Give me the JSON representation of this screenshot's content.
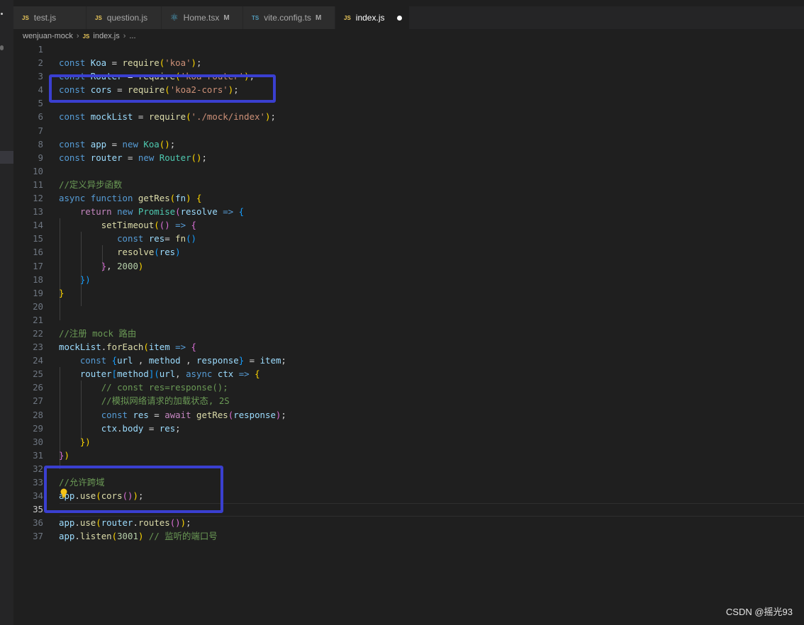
{
  "tabs": [
    {
      "label": "test.js",
      "icon": "JS",
      "type": "js",
      "modified": ""
    },
    {
      "label": "question.js",
      "icon": "JS",
      "type": "js",
      "modified": ""
    },
    {
      "label": "Home.tsx",
      "icon": "react",
      "type": "react",
      "modified": "M"
    },
    {
      "label": "vite.config.ts",
      "icon": "TS",
      "type": "ts",
      "modified": "M"
    },
    {
      "label": "index.js",
      "icon": "JS",
      "type": "js",
      "modified": "",
      "active": true,
      "unsaved": true
    }
  ],
  "breadcrumb": {
    "folder": "wenjuan-mock",
    "file": "index.js",
    "more": "...",
    "file_icon": "JS"
  },
  "lines": [
    {
      "n": "1",
      "tokens": []
    },
    {
      "n": "2",
      "tokens": [
        [
          "kw",
          "const "
        ],
        [
          "var",
          "Koa"
        ],
        [
          "pl",
          " = "
        ],
        [
          "fn",
          "require"
        ],
        [
          "b1",
          "("
        ],
        [
          "str",
          "'koa'"
        ],
        [
          "b1",
          ")"
        ],
        [
          "pl",
          ";"
        ]
      ]
    },
    {
      "n": "3",
      "tokens": [
        [
          "kw",
          "const "
        ],
        [
          "var",
          "Router"
        ],
        [
          "pl",
          " = "
        ],
        [
          "fn",
          "require"
        ],
        [
          "b1",
          "("
        ],
        [
          "str",
          "'koa-router'"
        ],
        [
          "b1",
          ")"
        ],
        [
          "pl",
          ";"
        ]
      ]
    },
    {
      "n": "4",
      "tokens": [
        [
          "kw",
          "const "
        ],
        [
          "var",
          "cors"
        ],
        [
          "pl",
          " = "
        ],
        [
          "fn",
          "require"
        ],
        [
          "b1",
          "("
        ],
        [
          "str",
          "'koa2-cors'"
        ],
        [
          "b1",
          ")"
        ],
        [
          "pl",
          ";"
        ]
      ]
    },
    {
      "n": "5",
      "tokens": []
    },
    {
      "n": "6",
      "tokens": [
        [
          "kw",
          "const "
        ],
        [
          "var",
          "mockList"
        ],
        [
          "pl",
          " = "
        ],
        [
          "fn",
          "require"
        ],
        [
          "b1",
          "("
        ],
        [
          "str",
          "'./mock/index'"
        ],
        [
          "b1",
          ")"
        ],
        [
          "pl",
          ";"
        ]
      ]
    },
    {
      "n": "7",
      "tokens": []
    },
    {
      "n": "8",
      "tokens": [
        [
          "kw",
          "const "
        ],
        [
          "var",
          "app"
        ],
        [
          "pl",
          " = "
        ],
        [
          "kw",
          "new "
        ],
        [
          "cls",
          "Koa"
        ],
        [
          "b1",
          "()"
        ],
        [
          "pl",
          ";"
        ]
      ]
    },
    {
      "n": "9",
      "tokens": [
        [
          "kw",
          "const "
        ],
        [
          "var",
          "router"
        ],
        [
          "pl",
          " = "
        ],
        [
          "kw",
          "new "
        ],
        [
          "cls",
          "Router"
        ],
        [
          "b1",
          "()"
        ],
        [
          "pl",
          ";"
        ]
      ]
    },
    {
      "n": "10",
      "tokens": []
    },
    {
      "n": "11",
      "tokens": [
        [
          "cm",
          "//定义异步函数"
        ]
      ]
    },
    {
      "n": "12",
      "tokens": [
        [
          "kw",
          "async "
        ],
        [
          "kw",
          "function "
        ],
        [
          "fn",
          "getRes"
        ],
        [
          "b1",
          "("
        ],
        [
          "var",
          "fn"
        ],
        [
          "b1",
          ")"
        ],
        [
          "pl",
          " "
        ],
        [
          "b1",
          "{"
        ]
      ]
    },
    {
      "n": "13",
      "tokens": [
        [
          "pl",
          "    "
        ],
        [
          "ctl",
          "return "
        ],
        [
          "kw",
          "new "
        ],
        [
          "cls",
          "Promise"
        ],
        [
          "b2",
          "("
        ],
        [
          "var",
          "resolve"
        ],
        [
          "pl",
          " "
        ],
        [
          "kw",
          "=>"
        ],
        [
          "pl",
          " "
        ],
        [
          "b3",
          "{"
        ]
      ]
    },
    {
      "n": "14",
      "tokens": [
        [
          "pl",
          "        "
        ],
        [
          "fn",
          "setTimeout"
        ],
        [
          "b1",
          "("
        ],
        [
          "b2",
          "()"
        ],
        [
          "pl",
          " "
        ],
        [
          "kw",
          "=>"
        ],
        [
          "pl",
          " "
        ],
        [
          "b2",
          "{"
        ]
      ]
    },
    {
      "n": "15",
      "tokens": [
        [
          "pl",
          "           "
        ],
        [
          "kw",
          "const "
        ],
        [
          "var",
          "res"
        ],
        [
          "pl",
          "= "
        ],
        [
          "fn",
          "fn"
        ],
        [
          "b3",
          "()"
        ]
      ]
    },
    {
      "n": "16",
      "tokens": [
        [
          "pl",
          "           "
        ],
        [
          "fn",
          "resolve"
        ],
        [
          "b3",
          "("
        ],
        [
          "var",
          "res"
        ],
        [
          "b3",
          ")"
        ]
      ]
    },
    {
      "n": "17",
      "tokens": [
        [
          "pl",
          "        "
        ],
        [
          "b2",
          "}"
        ],
        [
          "pl",
          ", "
        ],
        [
          "num",
          "2000"
        ],
        [
          "b1",
          ")"
        ]
      ]
    },
    {
      "n": "18",
      "tokens": [
        [
          "pl",
          "    "
        ],
        [
          "b3",
          "})"
        ]
      ]
    },
    {
      "n": "19",
      "tokens": [
        [
          "b1",
          "}"
        ]
      ]
    },
    {
      "n": "20",
      "tokens": []
    },
    {
      "n": "21",
      "tokens": []
    },
    {
      "n": "22",
      "tokens": [
        [
          "cm",
          "//注册 mock 路由"
        ]
      ]
    },
    {
      "n": "23",
      "tokens": [
        [
          "var",
          "mockList"
        ],
        [
          "pl",
          "."
        ],
        [
          "fn",
          "forEach"
        ],
        [
          "b1",
          "("
        ],
        [
          "var",
          "item"
        ],
        [
          "pl",
          " "
        ],
        [
          "kw",
          "=>"
        ],
        [
          "pl",
          " "
        ],
        [
          "b2",
          "{"
        ]
      ]
    },
    {
      "n": "24",
      "tokens": [
        [
          "pl",
          "    "
        ],
        [
          "kw",
          "const "
        ],
        [
          "b3",
          "{"
        ],
        [
          "var",
          "url"
        ],
        [
          "pl",
          " , "
        ],
        [
          "var",
          "method"
        ],
        [
          "pl",
          " , "
        ],
        [
          "var",
          "response"
        ],
        [
          "b3",
          "}"
        ],
        [
          "pl",
          " = "
        ],
        [
          "var",
          "item"
        ],
        [
          "pl",
          ";"
        ]
      ]
    },
    {
      "n": "25",
      "tokens": [
        [
          "pl",
          "    "
        ],
        [
          "var",
          "router"
        ],
        [
          "b3",
          "["
        ],
        [
          "var",
          "method"
        ],
        [
          "b3",
          "]"
        ],
        [
          "b3",
          "("
        ],
        [
          "var",
          "url"
        ],
        [
          "pl",
          ", "
        ],
        [
          "kw",
          "async "
        ],
        [
          "var",
          "ctx"
        ],
        [
          "pl",
          " "
        ],
        [
          "kw",
          "=>"
        ],
        [
          "pl",
          " "
        ],
        [
          "b1",
          "{"
        ]
      ]
    },
    {
      "n": "26",
      "tokens": [
        [
          "pl",
          "        "
        ],
        [
          "cm",
          "// const res=response();"
        ]
      ]
    },
    {
      "n": "27",
      "tokens": [
        [
          "pl",
          "        "
        ],
        [
          "cm",
          "//模拟网络请求的加载状态, 2S"
        ]
      ]
    },
    {
      "n": "28",
      "tokens": [
        [
          "pl",
          "        "
        ],
        [
          "kw",
          "const "
        ],
        [
          "var",
          "res"
        ],
        [
          "pl",
          " = "
        ],
        [
          "ctl",
          "await "
        ],
        [
          "fn",
          "getRes"
        ],
        [
          "b2",
          "("
        ],
        [
          "var",
          "response"
        ],
        [
          "b2",
          ")"
        ],
        [
          "pl",
          ";"
        ]
      ]
    },
    {
      "n": "29",
      "tokens": [
        [
          "pl",
          "        "
        ],
        [
          "var",
          "ctx"
        ],
        [
          "pl",
          "."
        ],
        [
          "var",
          "body"
        ],
        [
          "pl",
          " = "
        ],
        [
          "var",
          "res"
        ],
        [
          "pl",
          ";"
        ]
      ]
    },
    {
      "n": "30",
      "tokens": [
        [
          "pl",
          "    "
        ],
        [
          "b1",
          "})"
        ]
      ]
    },
    {
      "n": "31",
      "tokens": [
        [
          "b2",
          "}"
        ],
        [
          "b1",
          ")"
        ]
      ]
    },
    {
      "n": "32",
      "tokens": []
    },
    {
      "n": "33",
      "tokens": [
        [
          "cm",
          "//允许跨域"
        ]
      ]
    },
    {
      "n": "34",
      "tokens": [
        [
          "var",
          "app"
        ],
        [
          "pl",
          "."
        ],
        [
          "fn",
          "use"
        ],
        [
          "b1",
          "("
        ],
        [
          "fn",
          "cors"
        ],
        [
          "b2",
          "()"
        ],
        [
          "b1",
          ")"
        ],
        [
          "pl",
          ";"
        ]
      ]
    },
    {
      "n": "35",
      "tokens": [],
      "current": true
    },
    {
      "n": "36",
      "tokens": [
        [
          "var",
          "app"
        ],
        [
          "pl",
          "."
        ],
        [
          "fn",
          "use"
        ],
        [
          "b1",
          "("
        ],
        [
          "var",
          "router"
        ],
        [
          "pl",
          "."
        ],
        [
          "fn",
          "routes"
        ],
        [
          "b2",
          "()"
        ],
        [
          "b1",
          ")"
        ],
        [
          "pl",
          ";"
        ]
      ]
    },
    {
      "n": "37",
      "tokens": [
        [
          "var",
          "app"
        ],
        [
          "pl",
          "."
        ],
        [
          "fn",
          "listen"
        ],
        [
          "b1",
          "("
        ],
        [
          "num",
          "3001"
        ],
        [
          "b1",
          ")"
        ],
        [
          "pl",
          " "
        ],
        [
          "cm",
          "// 监听的端口号"
        ]
      ]
    }
  ],
  "watermark": "CSDN @摇光93",
  "colors": {
    "annotation_box": "#3a3fd0",
    "editor_bg": "#1f1f1f"
  }
}
